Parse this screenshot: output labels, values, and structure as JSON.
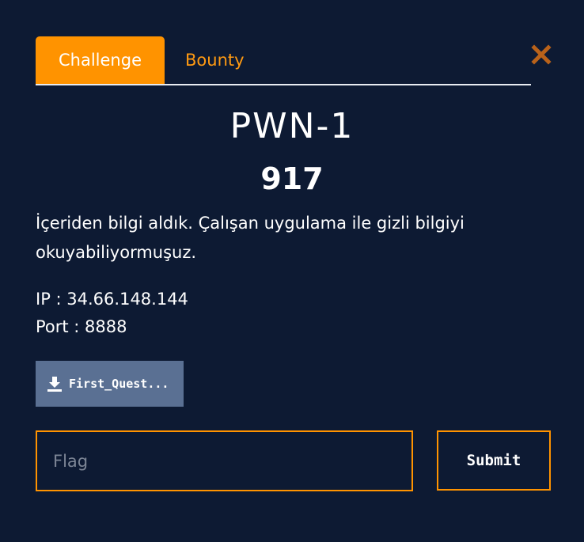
{
  "tabs": {
    "active": "Challenge",
    "inactive": "Bounty"
  },
  "challenge": {
    "title": "PWN-1",
    "points": "917",
    "description": "İçeriden bilgi aldık. Çalışan uygulama ile gizli bilgiyi okuyabiliyormuşuz.",
    "ip_line": "IP : 34.66.148.144",
    "port_line": "Port : 8888"
  },
  "download": {
    "label": "First_Quest...",
    "icon": "download-icon"
  },
  "form": {
    "flag_placeholder": "Flag",
    "flag_value": "",
    "submit_label": "Submit"
  },
  "colors": {
    "background": "#0d1a33",
    "accent": "#ff9300",
    "download_bg": "#5a7093",
    "close": "#b9621a"
  },
  "icons": {
    "close": "close-icon"
  }
}
